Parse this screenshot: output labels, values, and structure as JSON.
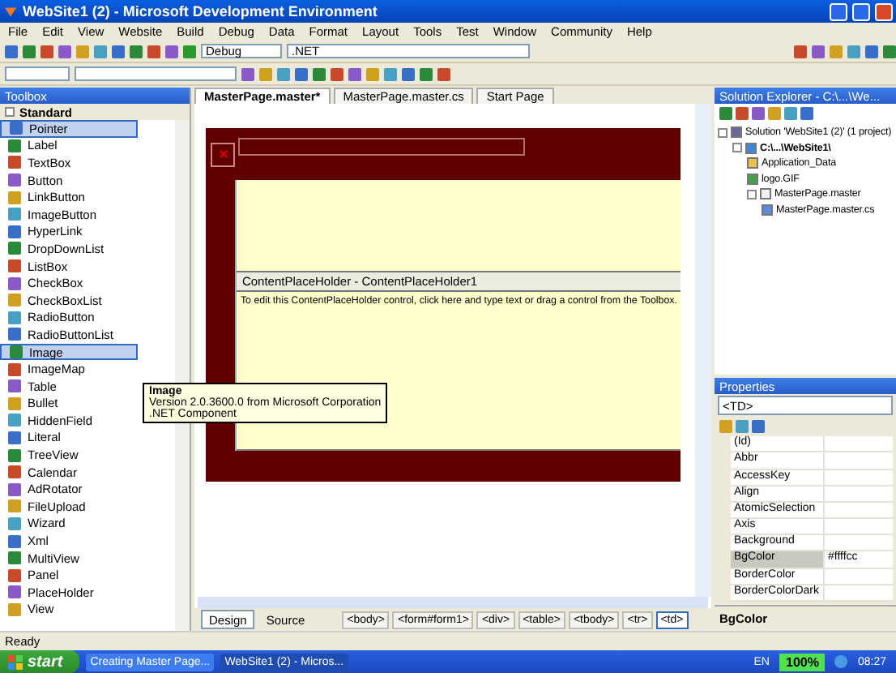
{
  "window": {
    "title": "WebSite1 (2) - Microsoft Development Environment"
  },
  "menu": [
    "File",
    "Edit",
    "View",
    "Website",
    "Build",
    "Debug",
    "Data",
    "Format",
    "Layout",
    "Tools",
    "Test",
    "Window",
    "Community",
    "Help"
  ],
  "toolbar": {
    "configuration": "Debug",
    "platform": ".NET"
  },
  "toolbox": {
    "title": "Toolbox",
    "section": "Standard",
    "section_expanded": true,
    "items": [
      {
        "label": "Pointer",
        "selected": true
      },
      {
        "label": "Label",
        "selected": false
      },
      {
        "label": "TextBox",
        "selected": false
      },
      {
        "label": "Button",
        "selected": false
      },
      {
        "label": "LinkButton",
        "selected": false
      },
      {
        "label": "ImageButton",
        "selected": false
      },
      {
        "label": "HyperLink",
        "selected": false
      },
      {
        "label": "DropDownList",
        "selected": false
      },
      {
        "label": "ListBox",
        "selected": false
      },
      {
        "label": "CheckBox",
        "selected": false
      },
      {
        "label": "CheckBoxList",
        "selected": false
      },
      {
        "label": "RadioButton",
        "selected": false
      },
      {
        "label": "RadioButtonList",
        "selected": false
      },
      {
        "label": "Image",
        "selected": true
      },
      {
        "label": "ImageMap",
        "selected": false
      },
      {
        "label": "Table",
        "selected": false
      },
      {
        "label": "Bullet",
        "selected": false
      },
      {
        "label": "HiddenField",
        "selected": false
      },
      {
        "label": "Literal",
        "selected": false
      },
      {
        "label": "TreeView",
        "selected": false
      },
      {
        "label": "Calendar",
        "selected": false
      },
      {
        "label": "AdRotator",
        "selected": false
      },
      {
        "label": "FileUpload",
        "selected": false
      },
      {
        "label": "Wizard",
        "selected": false
      },
      {
        "label": "Xml",
        "selected": false
      },
      {
        "label": "MultiView",
        "selected": false
      },
      {
        "label": "Panel",
        "selected": false
      },
      {
        "label": "PlaceHolder",
        "selected": false
      },
      {
        "label": "View",
        "selected": false
      }
    ],
    "tooltip": {
      "title": "Image",
      "lines": [
        "Version 2.0.3600.0 from Microsoft Corporation",
        ".NET Component"
      ]
    }
  },
  "editor": {
    "tabs": [
      {
        "label": "MasterPage.master*",
        "selected": true
      },
      {
        "label": "MasterPage.master.cs",
        "selected": false
      },
      {
        "label": "Start Page",
        "selected": false
      }
    ],
    "placeholder_title": "ContentPlaceHolder - ContentPlaceHolder1",
    "placeholder_text": "To edit this ContentPlaceHolder control, click here and type text or drag a control from the Toolbox.",
    "views": [
      {
        "label": "Design",
        "selected": true
      },
      {
        "label": "Source",
        "selected": false
      }
    ],
    "tags": [
      {
        "label": "<body>",
        "selected": false
      },
      {
        "label": "<form#form1>",
        "selected": false
      },
      {
        "label": "<div>",
        "selected": false
      },
      {
        "label": "<table>",
        "selected": false
      },
      {
        "label": "<tbody>",
        "selected": false
      },
      {
        "label": "<tr>",
        "selected": false
      },
      {
        "label": "<td>",
        "selected": true
      }
    ]
  },
  "solution_explorer": {
    "title": "Solution Explorer - C:\\...\\We...",
    "tree": [
      {
        "label": "Solution 'WebSite1 (2)' (1 project)",
        "kind": "solution",
        "expanded": true,
        "children": [
          {
            "label": "C:\\...\\WebSite1\\",
            "kind": "project",
            "expanded": true,
            "children": [
              {
                "label": "Application_Data",
                "kind": "folder"
              },
              {
                "label": "logo.GIF",
                "kind": "image"
              },
              {
                "label": "MasterPage.master",
                "kind": "page",
                "expanded": true,
                "children": [
                  {
                    "label": "MasterPage.master.cs",
                    "kind": "code"
                  }
                ]
              }
            ]
          }
        ]
      }
    ]
  },
  "properties": {
    "title": "Properties",
    "object": "<TD>",
    "rows": [
      {
        "name": "(Id)",
        "value": "",
        "selected": false
      },
      {
        "name": "Abbr",
        "selected": false
      },
      {
        "name": "AccessKey",
        "selected": false
      },
      {
        "name": "Align",
        "selected": false
      },
      {
        "name": "AtomicSelection",
        "selected": false
      },
      {
        "name": "Axis",
        "selected": false
      },
      {
        "name": "Background",
        "selected": false
      },
      {
        "name": "BgColor",
        "value": "#ffffcc",
        "selected": true
      },
      {
        "name": "BorderColor",
        "selected": false
      },
      {
        "name": "BorderColorDark",
        "selected": false
      }
    ],
    "description": "BgColor"
  },
  "status_bar": "Ready",
  "taskbar": {
    "start": "start",
    "tasks": [
      {
        "label": "Creating Master Page...",
        "selected": false
      },
      {
        "label": "WebSite1 (2) - Micros...",
        "selected": true
      }
    ],
    "language": "EN",
    "battery": "100%",
    "clock": "08:27"
  }
}
